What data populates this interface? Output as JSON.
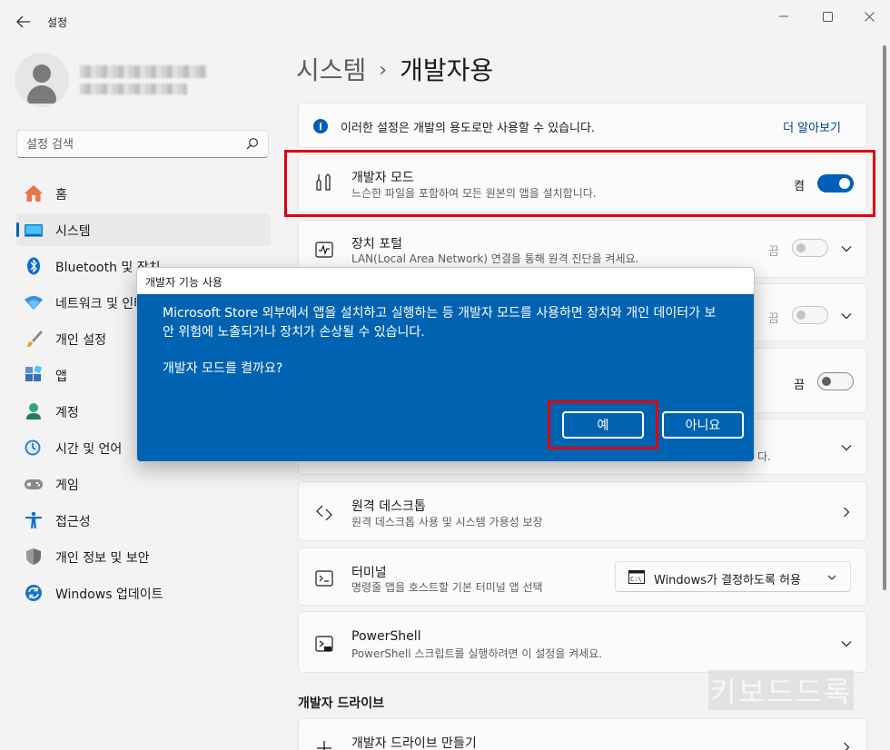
{
  "window": {
    "title": "설정",
    "back_icon": "arrow-left-icon",
    "controls": [
      "minimize",
      "maximize",
      "close"
    ]
  },
  "sidebar": {
    "search_placeholder": "설정 검색",
    "items": [
      {
        "label": "홈",
        "icon": "home-icon",
        "active": false
      },
      {
        "label": "시스템",
        "icon": "system-icon",
        "active": true
      },
      {
        "label": "Bluetooth 및 장치",
        "icon": "bluetooth-icon",
        "active": false
      },
      {
        "label": "네트워크 및 인터넷",
        "icon": "wifi-icon",
        "active": false
      },
      {
        "label": "개인 설정",
        "icon": "brush-icon",
        "active": false
      },
      {
        "label": "앱",
        "icon": "apps-icon",
        "active": false
      },
      {
        "label": "계정",
        "icon": "account-icon",
        "active": false
      },
      {
        "label": "시간 및 언어",
        "icon": "time-language-icon",
        "active": false
      },
      {
        "label": "게임",
        "icon": "gamepad-icon",
        "active": false
      },
      {
        "label": "접근성",
        "icon": "accessibility-icon",
        "active": false
      },
      {
        "label": "개인 정보 및 보안",
        "icon": "shield-icon",
        "active": false
      },
      {
        "label": "Windows 업데이트",
        "icon": "update-icon",
        "active": false
      }
    ]
  },
  "breadcrumb": {
    "parent": "시스템",
    "separator": "›",
    "current": "개발자용"
  },
  "info": {
    "text": "이러한 설정은 개발의 용도로만 사용할 수 있습니다.",
    "link": "더 알아보기"
  },
  "dev_mode": {
    "title": "개발자 모드",
    "desc": "느슨한 파일을 포함하여 모든 원본의 앱을 설치합니다.",
    "state_label": "켬",
    "on": true
  },
  "device_portal": {
    "title": "장치 포털",
    "desc": "LAN(Local Area Network) 연결을 통해 원격 진단을 켜세요.",
    "state_label": "끔"
  },
  "hidden_row": {
    "state_label": "끔"
  },
  "row4": {
    "state_label": "끔"
  },
  "row5": {
    "desc_tail": "다."
  },
  "remote_desktop": {
    "title": "원격 데스크톱",
    "desc": "원격 데스크톱 사용 및 시스템 가용성 보장"
  },
  "terminal": {
    "title": "터미널",
    "desc": "명령줄 앱을 호스트할 기본 터미널 앱 선택",
    "dropdown_value": "Windows가 결정하도록 허용"
  },
  "powershell": {
    "title": "PowerShell",
    "desc": "PowerShell 스크립트를 실행하려면 이 설정을 켜세요."
  },
  "dev_drive": {
    "section_title": "개발자 드라이브",
    "create_title": "개발자 드라이브 만들기"
  },
  "watermark": "키보드드록",
  "dialog": {
    "title": "개발자 기능 사용",
    "message": "Microsoft Store 외부에서 앱을 설치하고 실행하는 등 개발자 모드를 사용하면 장치와 개인 데이터가 보안 위험에 노출되거나 장치가 손상될 수 있습니다.",
    "question": "개발자 모드를 켤까요?",
    "yes": "예",
    "no": "아니요"
  },
  "colors": {
    "accent": "#005fb8",
    "dialog_bg": "#0063b1",
    "highlight": "#e0000e"
  }
}
